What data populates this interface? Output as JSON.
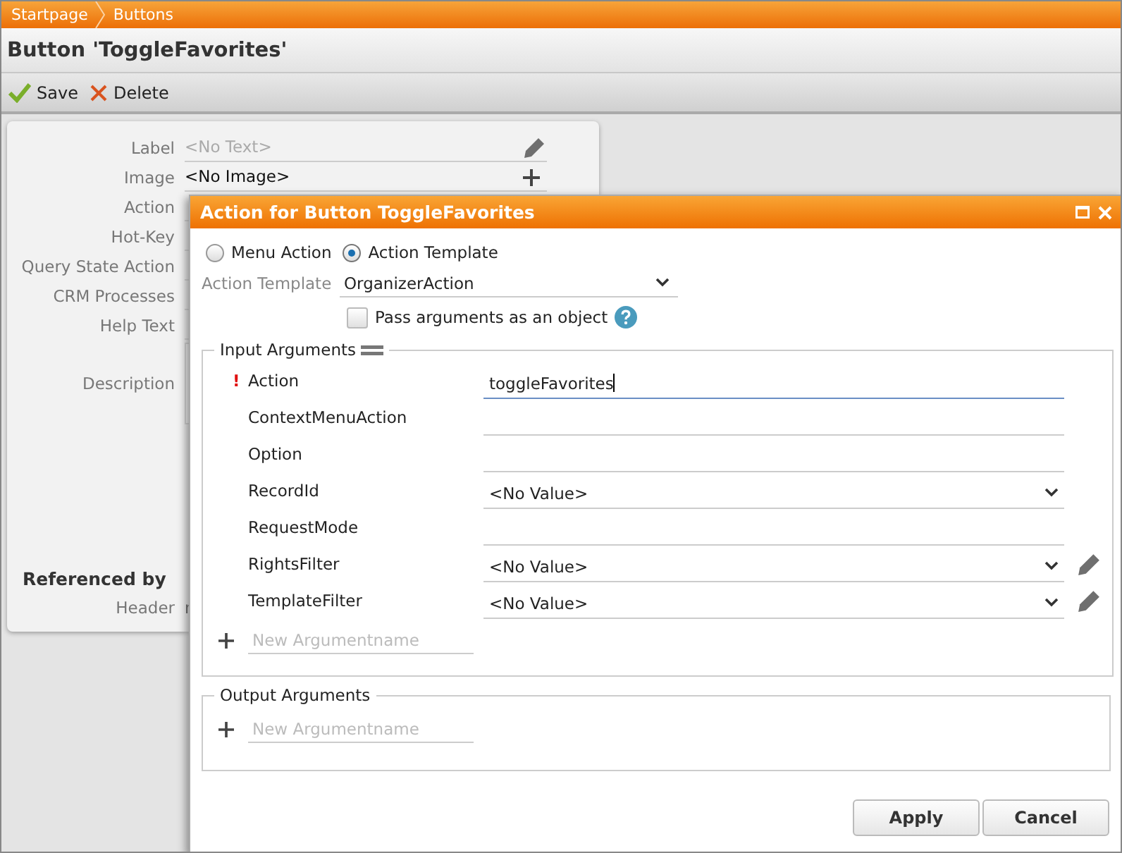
{
  "breadcrumb": [
    {
      "label": "Startpage"
    },
    {
      "label": "Buttons"
    }
  ],
  "title": "Button 'ToggleFavorites'",
  "toolbar": [
    {
      "label": "Save",
      "kind": "save"
    },
    {
      "label": "Delete",
      "kind": "delete"
    }
  ],
  "form": {
    "fields": [
      {
        "label": "Label",
        "placeholder": "<No Text>",
        "kind": "text",
        "editable": true,
        "can_add": false
      },
      {
        "label": "Image",
        "value": "<No Image>",
        "kind": "text",
        "editable": false,
        "can_add": true
      },
      {
        "label": "Action",
        "kind": "text"
      },
      {
        "label": "Hot-Key",
        "kind": "text"
      },
      {
        "label": "Query State Action",
        "kind": "text"
      },
      {
        "label": "CRM Processes",
        "kind": "text"
      },
      {
        "label": "Help Text",
        "kind": "text"
      },
      {
        "label": "Description",
        "kind": "textarea"
      }
    ],
    "referenced_by": {
      "heading": "Referenced by",
      "rows": [
        {
          "label": "Header",
          "value": "r"
        }
      ]
    }
  },
  "dialog": {
    "title": "Action for Button ToggleFavorites",
    "radios": [
      {
        "label": "Menu Action",
        "selected": false
      },
      {
        "label": "Action Template",
        "selected": true
      }
    ],
    "action_template": {
      "label": "Action Template",
      "value": "OrganizerAction"
    },
    "pass_object": {
      "label": "Pass arguments as an object",
      "checked": false
    },
    "input_arguments": {
      "legend": "Input Arguments",
      "required_sign": "!",
      "rows": [
        {
          "name": "Action",
          "required": true,
          "kind": "text",
          "value": "toggleFavorites",
          "focused": true
        },
        {
          "name": "ContextMenuAction",
          "required": false,
          "kind": "text",
          "focused": false
        },
        {
          "name": "Option",
          "required": false,
          "kind": "text",
          "focused": false
        },
        {
          "name": "RecordId",
          "required": false,
          "kind": "select",
          "value": "<No Value>",
          "focused": false
        },
        {
          "name": "RequestMode",
          "required": false,
          "kind": "text",
          "focused": false
        },
        {
          "name": "RightsFilter",
          "required": false,
          "kind": "select",
          "value": "<No Value>",
          "editable": true,
          "focused": false
        },
        {
          "name": "TemplateFilter",
          "required": false,
          "kind": "select",
          "value": "<No Value>",
          "editable": true,
          "focused": false
        }
      ],
      "new_placeholder": "New Argumentname"
    },
    "output_arguments": {
      "legend": "Output Arguments",
      "new_placeholder": "New Argumentname"
    },
    "buttons": [
      {
        "label": "Apply"
      },
      {
        "label": "Cancel"
      }
    ]
  }
}
